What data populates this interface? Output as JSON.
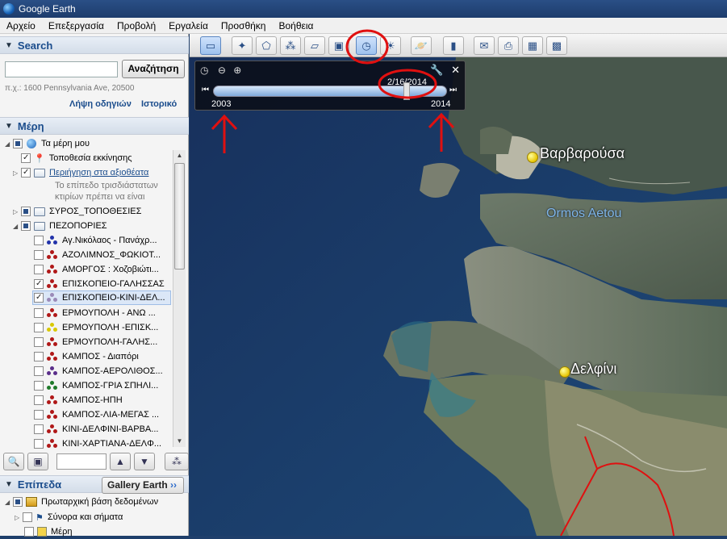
{
  "window": {
    "title": "Google Earth"
  },
  "menu": [
    "Αρχείο",
    "Επεξεργασία",
    "Προβολή",
    "Εργαλεία",
    "Προσθήκη",
    "Βοήθεια"
  ],
  "search": {
    "header": "Search",
    "button": "Αναζήτηση",
    "hint": "π.χ.: 1600 Pennsylvania Ave, 20500",
    "link_directions": "Λήψη οδηγιών",
    "link_history": "Ιστορικό"
  },
  "places": {
    "header": "Μέρη",
    "items": [
      {
        "label": "Τα μέρη μου"
      },
      {
        "label": "Τοποθεσία εκκίνησης"
      },
      {
        "label": "Περιήγηση στα αξιοθέατα"
      },
      {
        "label": "Το επίπεδο τρισδιάστατων"
      },
      {
        "label": "κτιρίων πρέπει να είναι"
      },
      {
        "label": "ΣΥΡΟΣ_ΤΟΠΟΘΕΣΙΕΣ"
      },
      {
        "label": "ΠΕΖΟΠΟΡΙΕΣ"
      },
      {
        "label": "Αγ.Νικόλαος - Πανάχρ..."
      },
      {
        "label": "ΑΖΟΛΙΜΝΟΣ_ΦΩΚΙΟΤ..."
      },
      {
        "label": "ΑΜΟΡΓΟΣ : Χοζοβιώτι..."
      },
      {
        "label": "ΕΠΙΣΚΟΠΕΙΟ-ΓΑΛΗΣΣΑΣ"
      },
      {
        "label": "ΕΠΙΣΚΟΠΕΙΟ-ΚΙΝΙ-ΔΕΛ..."
      },
      {
        "label": "ΕΡΜΟΥΠΟΛΗ - ΑΝΩ ..."
      },
      {
        "label": "ΕΡΜΟΥΠΟΛΗ -ΕΠΙΣΚ..."
      },
      {
        "label": "ΕΡΜΟΥΠΟΛΗ-ΓΑΛΗΣ..."
      },
      {
        "label": "ΚΑΜΠΟΣ - Διαπόρι"
      },
      {
        "label": "ΚΑΜΠΟΣ-ΑΕΡΟΛΙΘΟΣ..."
      },
      {
        "label": "ΚΑΜΠΟΣ-ΓΡΙΑ ΣΠΗΛΙ..."
      },
      {
        "label": "ΚΑΜΠΟΣ-ΗΠΗ"
      },
      {
        "label": "ΚΑΜΠΟΣ-ΛΙΑ-ΜΕΓΑΣ ..."
      },
      {
        "label": "ΚΙΝΙ-ΔΕΛΦΙΝΙ-ΒΑΡΒΑ..."
      },
      {
        "label": "ΚΙΝΙ-ΧΑΡΤΙΑΝΑ-ΔΕΛΦ..."
      }
    ]
  },
  "layers": {
    "header": "Επίπεδα",
    "gallery_button": "Gallery Earth",
    "items": [
      {
        "label": "Πρωταρχική βάση δεδομένων"
      },
      {
        "label": "Σύνορα και σήματα"
      },
      {
        "label": "Μέρη"
      }
    ]
  },
  "timeslider": {
    "current_date": "2/16/2014",
    "start_year": "2003",
    "end_year": "2014"
  },
  "map": {
    "labels": {
      "varvarousa": "Βαρβαρούσα",
      "ormos": "Ormos Aetou",
      "delfini": "Δελφίνι"
    }
  },
  "colors": {
    "annotation_red": "#e01010",
    "link_blue": "#1a4c8c"
  }
}
